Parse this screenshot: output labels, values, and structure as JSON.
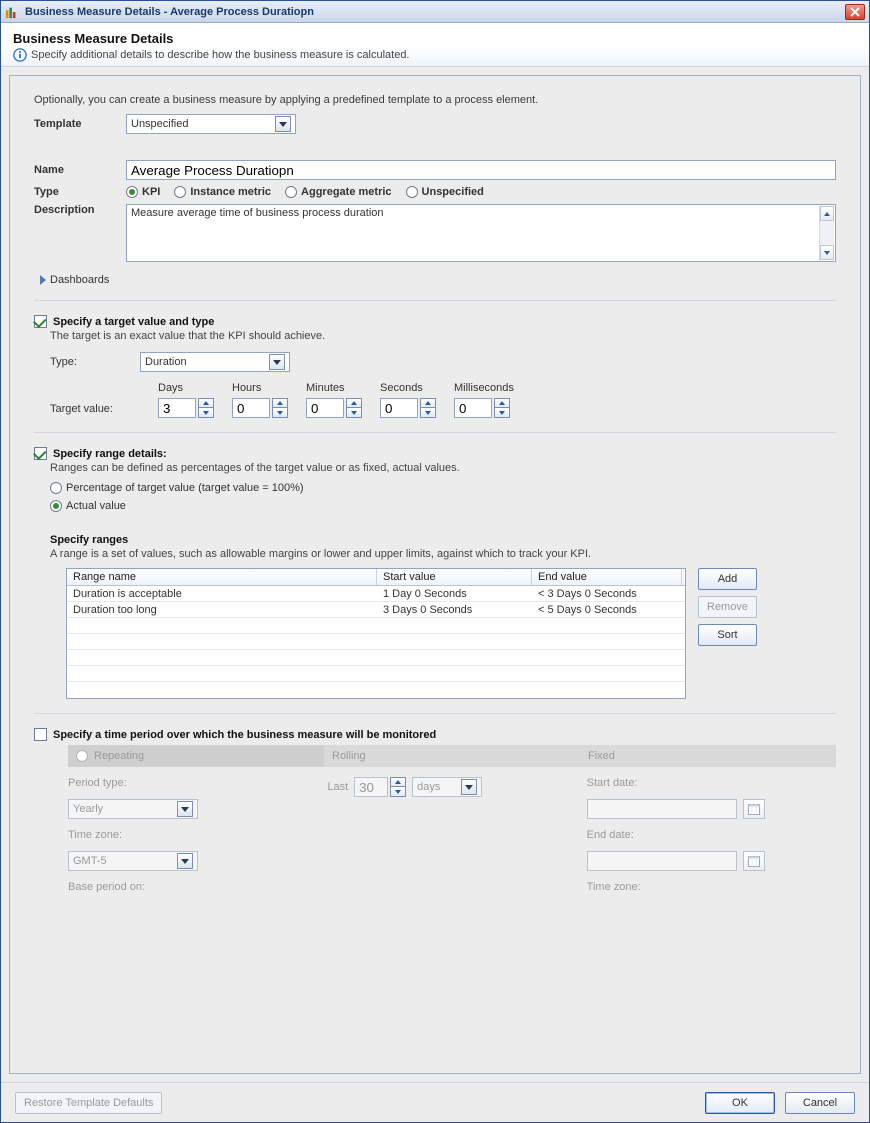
{
  "window": {
    "title": "Business Measure Details - Average Process Duratiopn"
  },
  "header": {
    "title": "Business Measure Details",
    "subtitle": "Specify additional details to describe how the business measure is calculated."
  },
  "intro": "Optionally, you can create a business measure by applying a predefined template to a process element.",
  "labels": {
    "template": "Template",
    "name": "Name",
    "type": "Type",
    "description": "Description",
    "dashboards": "Dashboards"
  },
  "template_value": "Unspecified",
  "name_value": "Average Process Duratiopn",
  "type_options": {
    "kpi": "KPI",
    "instance": "Instance metric",
    "aggregate": "Aggregate metric",
    "unspecified": "Unspecified"
  },
  "description_value": "Measure average time of business process duration",
  "target": {
    "check_label": "Specify a target value and type",
    "hint": "The target is an exact value that the KPI should achieve.",
    "type_label": "Type:",
    "type_value": "Duration",
    "value_label": "Target value:",
    "cols": {
      "days": "Days",
      "hours": "Hours",
      "minutes": "Minutes",
      "seconds": "Seconds",
      "ms": "Milliseconds"
    },
    "vals": {
      "days": "3",
      "hours": "0",
      "minutes": "0",
      "seconds": "0",
      "ms": "0"
    }
  },
  "range": {
    "check_label": "Specify range details:",
    "hint": "Ranges can be defined as percentages of the target value or as fixed, actual values.",
    "opt_pct": "Percentage of target value (target value = 100%)",
    "opt_actual": "Actual value",
    "sub_title": "Specify ranges",
    "sub_hint": "A range is a set of values, such as allowable margins or lower and upper limits, against which to track your KPI.",
    "headers": {
      "name": "Range name",
      "start": "Start value",
      "end": "End value"
    },
    "rows": [
      {
        "name": "Duration is acceptable",
        "start": "1 Day  0 Seconds",
        "end": "< 3 Days  0 Seconds"
      },
      {
        "name": "Duration too long",
        "start": "3 Days  0 Seconds",
        "end": "< 5 Days  0 Seconds"
      }
    ],
    "buttons": {
      "add": "Add",
      "remove": "Remove",
      "sort": "Sort"
    }
  },
  "period": {
    "check_label": "Specify a time period over which the business measure will be monitored",
    "tabs": {
      "repeating": "Repeating",
      "rolling": "Rolling",
      "fixed": "Fixed"
    },
    "repeating": {
      "period_type_label": "Period type:",
      "period_type_value": "Yearly",
      "tz_label": "Time zone:",
      "tz_value": "GMT-5",
      "base_label": "Base period on:"
    },
    "rolling": {
      "last_label": "Last",
      "qty": "30",
      "unit": "days"
    },
    "fixed": {
      "start_label": "Start date:",
      "end_label": "End date:",
      "tz_label": "Time zone:"
    }
  },
  "footer": {
    "restore": "Restore Template Defaults",
    "ok": "OK",
    "cancel": "Cancel"
  }
}
